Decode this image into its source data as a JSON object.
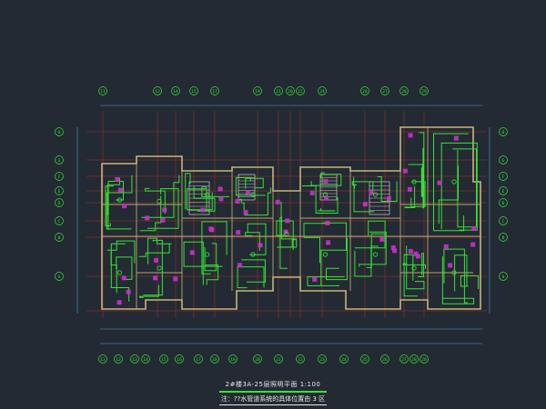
{
  "drawing": {
    "title": "2#楼3A-25层照明平面 1:100",
    "subtitle": "注：??水管道系统的具体位置由 3 区"
  },
  "grid_axes": {
    "top": [
      "11",
      "12",
      "14",
      "15",
      "17",
      "19",
      "21",
      "20",
      "22",
      "24",
      "26",
      "27",
      "28",
      "29"
    ],
    "bottom": [
      "11",
      "12",
      "13",
      "14",
      "15",
      "16",
      "17",
      "18",
      "19",
      "20",
      "21",
      "22",
      "23",
      "24",
      "25",
      "26",
      "27",
      "28",
      "29"
    ],
    "left": [
      "H",
      "G",
      "F",
      "E",
      "D",
      "C",
      "B",
      "A"
    ],
    "right": [
      "H",
      "G",
      "F",
      "E",
      "D",
      "C",
      "B",
      "A"
    ]
  },
  "colors": {
    "background": "#232a33",
    "grid_line": "#c83232",
    "wall": "#c8b478",
    "wiring": "#36e336",
    "fixture": "#c832c8",
    "dimension": "#4aa3c8",
    "text": "#e8e8e8"
  }
}
